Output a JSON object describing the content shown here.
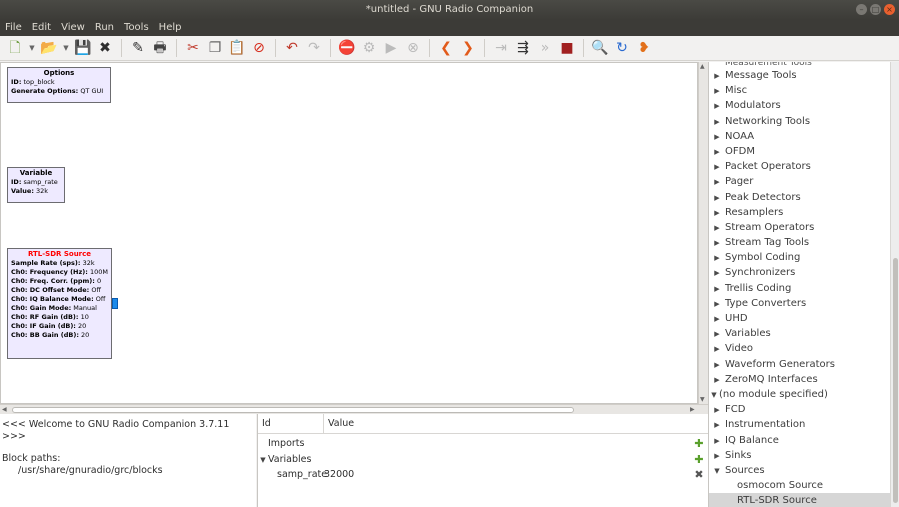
{
  "window": {
    "title": "*untitled - GNU Radio Companion"
  },
  "menubar": [
    "File",
    "Edit",
    "View",
    "Run",
    "Tools",
    "Help"
  ],
  "toolbar": {
    "tools": [
      {
        "name": "new-icon",
        "glyph": "🗋",
        "color": "#6a9a3a"
      },
      {
        "name": "open-icon",
        "glyph": "📂",
        "color": "#d04a1a"
      },
      {
        "name": "save-icon",
        "glyph": "💾",
        "color": "#3a7a2a"
      },
      {
        "name": "close-icon",
        "glyph": "✖",
        "color": "#2e2e2e"
      },
      {
        "name": "edit-icon",
        "glyph": "✎",
        "color": "#333"
      },
      {
        "name": "print-icon",
        "glyph": "🖶",
        "color": "#444"
      },
      {
        "name": "cut-icon",
        "glyph": "✂",
        "color": "#c0392b"
      },
      {
        "name": "copy-icon",
        "glyph": "❐",
        "color": "#666"
      },
      {
        "name": "paste-icon",
        "glyph": "📋",
        "color": "#888"
      },
      {
        "name": "delete-icon",
        "glyph": "⊘",
        "color": "#d62a1a"
      },
      {
        "name": "undo-icon",
        "glyph": "↶",
        "color": "#c0392b"
      },
      {
        "name": "redo-icon",
        "glyph": "↷",
        "color": "#bbb"
      },
      {
        "name": "disable-icon",
        "glyph": "⛔",
        "color": "#d62a1a"
      },
      {
        "name": "generate-icon",
        "glyph": "⚙",
        "color": "#bbb"
      },
      {
        "name": "execute-icon",
        "glyph": "▶",
        "color": "#bbb"
      },
      {
        "name": "kill-icon",
        "glyph": "⊗",
        "color": "#bbb"
      },
      {
        "name": "rotate-left-icon",
        "glyph": "❮",
        "color": "#e25a1a"
      },
      {
        "name": "rotate-right-icon",
        "glyph": "❯",
        "color": "#e25a1a"
      },
      {
        "name": "bypass-icon",
        "glyph": "⇥",
        "color": "#bbb"
      },
      {
        "name": "enable-icon",
        "glyph": "⇶",
        "color": "#333"
      },
      {
        "name": "forward-icon",
        "glyph": "»",
        "color": "#bbb"
      },
      {
        "name": "screenshot-icon",
        "glyph": "■",
        "color": "#a12020"
      },
      {
        "name": "find-icon",
        "glyph": "🔍",
        "color": "#2a6ad0"
      },
      {
        "name": "reload-icon",
        "glyph": "↻",
        "color": "#2a6ad0"
      },
      {
        "name": "block-params-icon",
        "glyph": "❥",
        "color": "#e2701a"
      }
    ]
  },
  "canvas": {
    "options_block": {
      "title": "Options",
      "rows": [
        {
          "label": "ID:",
          "value": "top_block"
        },
        {
          "label": "Generate Options:",
          "value": "QT GUI"
        }
      ]
    },
    "variable_block": {
      "title": "Variable",
      "rows": [
        {
          "label": "ID:",
          "value": "samp_rate"
        },
        {
          "label": "Value:",
          "value": "32k"
        }
      ]
    },
    "rtlsdr_block": {
      "title": "RTL-SDR Source",
      "rows": [
        {
          "label": "Sample Rate (sps):",
          "value": "32k"
        },
        {
          "label": "Ch0: Frequency (Hz):",
          "value": "100M"
        },
        {
          "label": "Ch0: Freq. Corr. (ppm):",
          "value": "0"
        },
        {
          "label": "Ch0: DC Offset Mode:",
          "value": "Off"
        },
        {
          "label": "Ch0: IQ Balance Mode:",
          "value": "Off"
        },
        {
          "label": "Ch0: Gain Mode:",
          "value": "Manual"
        },
        {
          "label": "Ch0: RF Gain (dB):",
          "value": "10"
        },
        {
          "label": "Ch0: IF Gain (dB):",
          "value": "20"
        },
        {
          "label": "Ch0: BB Gain (dB):",
          "value": "20"
        }
      ]
    }
  },
  "console": {
    "welcome": "<<< Welcome to GNU Radio Companion 3.7.11 >>>",
    "block_paths_label": "Block paths:",
    "block_path": "/usr/share/gnuradio/grc/blocks"
  },
  "variables_panel": {
    "header_id": "Id",
    "header_value": "Value",
    "imports_label": "Imports",
    "variables_label": "Variables",
    "var_name": "samp_rate",
    "var_value": "32000"
  },
  "block_tree": {
    "top_cut": "Measurement Tools",
    "items": [
      {
        "label": "Message Tools"
      },
      {
        "label": "Misc"
      },
      {
        "label": "Modulators"
      },
      {
        "label": "Networking Tools"
      },
      {
        "label": "NOAA"
      },
      {
        "label": "OFDM"
      },
      {
        "label": "Packet Operators"
      },
      {
        "label": "Pager"
      },
      {
        "label": "Peak Detectors"
      },
      {
        "label": "Resamplers"
      },
      {
        "label": "Stream Operators"
      },
      {
        "label": "Stream Tag Tools"
      },
      {
        "label": "Symbol Coding"
      },
      {
        "label": "Synchronizers"
      },
      {
        "label": "Trellis Coding"
      },
      {
        "label": "Type Converters"
      },
      {
        "label": "UHD"
      },
      {
        "label": "Variables"
      },
      {
        "label": "Video"
      },
      {
        "label": "Waveform Generators"
      },
      {
        "label": "ZeroMQ Interfaces"
      }
    ],
    "no_module_label": "(no module specified)",
    "no_module_items": [
      "FCD",
      "Instrumentation",
      "IQ Balance",
      "Sinks"
    ],
    "sources_label": "Sources",
    "source_children": [
      "osmocom Source",
      "RTL-SDR Source"
    ]
  }
}
